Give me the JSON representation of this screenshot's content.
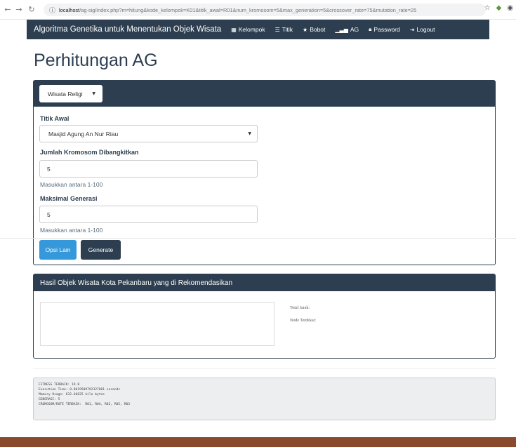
{
  "browser": {
    "back_icon": "arrow-left-icon",
    "url_host": "localhost",
    "url_rest": "/ag-sig/index.php?m=hitung&kode_kelompok=K01&titik_awal=R01&num_kromosom=5&max_generation=5&crossover_rate=75&mutation_rate=25"
  },
  "navbar": {
    "brand": "Algoritma Genetika untuk Menentukan Objek Wisata",
    "items": [
      {
        "label": "Kelompok",
        "icon": "grid-icon"
      },
      {
        "label": "Titik",
        "icon": "list-icon"
      },
      {
        "label": "Bobot",
        "icon": "star-icon"
      },
      {
        "label": "AG",
        "icon": "signal-icon"
      },
      {
        "label": "Password",
        "icon": "lock-icon"
      },
      {
        "label": "Logout",
        "icon": "logout-icon"
      }
    ],
    "color": "#2c3e50"
  },
  "page": {
    "title": "Perhitungan AG"
  },
  "form": {
    "group_select": "Wisata Religi",
    "start_label": "Titik Awal",
    "start_value": "Masjid Agung An Nur Riau",
    "chromosome_label": "Jumlah Kromosom Dibangkitkan",
    "chromosome_value": "5",
    "chromosome_help": "Masukkan antara 1-100",
    "generation_label": "Maksimal Generasi",
    "generation_value": "5",
    "generation_help": "Masukkan antara 1-100",
    "options_button": "Opsi Lain",
    "generate_button": "Generate"
  },
  "result": {
    "title": "Hasil Objek Wisata Kota Pekanbaru yang di Rekomendasikan",
    "total_distance_label": "Total Jarak:",
    "nearest_node_label": "Node Terdekat:"
  },
  "log": {
    "lines": [
      "FITNESS TERBAIK: 19.8",
      "Execution Time: 0.0019509792327881 seconds",
      "Memory Usage: 632.40625 kilo bytes",
      "GENERASI: 5",
      "CROMOSOM/RUTE TERBAIK:  R01, R04, R02, R05, R03"
    ]
  },
  "colors": {
    "primary": "#2c3e50",
    "info": "#3498db",
    "footer": "#8a4a2d"
  }
}
